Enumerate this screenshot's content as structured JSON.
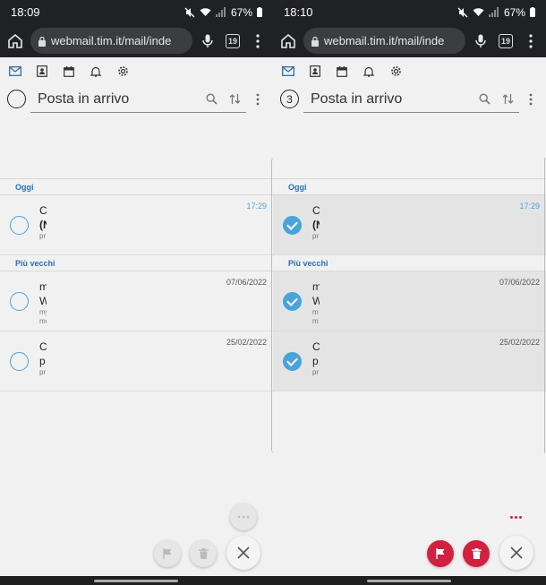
{
  "colors": {
    "accent_blue": "#4aa3d9",
    "section_blue": "#2a6fb2",
    "action_red": "#d1213f",
    "status_bar_bg": "#202124"
  },
  "left": {
    "status": {
      "time": "18:09",
      "battery": "67%"
    },
    "browser": {
      "url": "webmail.tim.it/mail/inde",
      "tab_count": "19"
    },
    "header": {
      "title": "Posta in arrivo",
      "selected_count": ""
    },
    "sections": {
      "today": "Oggi",
      "older": "Più vecchi"
    },
    "messages": [
      {
        "line1": "C",
        "line2": "(N",
        "line3": "pr",
        "date": "17:29"
      },
      {
        "line1": "m",
        "line2": "W",
        "line3": "my",
        "line4": "mo",
        "date": "07/06/2022"
      },
      {
        "line1": "C",
        "line2": "p",
        "line3": "pr",
        "date": "25/02/2022"
      }
    ]
  },
  "right": {
    "status": {
      "time": "18:10",
      "battery": "67%"
    },
    "browser": {
      "url": "webmail.tim.it/mail/inde",
      "tab_count": "19"
    },
    "header": {
      "title": "Posta in arrivo",
      "selected_count": "3"
    },
    "sections": {
      "today": "Oggi",
      "older": "Più vecchi"
    },
    "messages": [
      {
        "line1": "C",
        "line2": "(N",
        "line3": "pr",
        "date": "17:29"
      },
      {
        "line1": "m",
        "line2": "W",
        "line3": "m",
        "line4": "m",
        "date": "07/06/2022"
      },
      {
        "line1": "C",
        "line2": "p",
        "line3": "pr",
        "date": "25/02/2022"
      }
    ]
  },
  "icons": {
    "toolbar": [
      "mail-icon",
      "contacts-icon",
      "calendar-icon",
      "bell-icon",
      "gear-icon"
    ],
    "header": [
      "search-icon",
      "sort-icon",
      "more-vertical-icon"
    ],
    "actions": [
      "flag-icon",
      "trash-icon",
      "close-icon",
      "more-horizontal-icon"
    ]
  }
}
